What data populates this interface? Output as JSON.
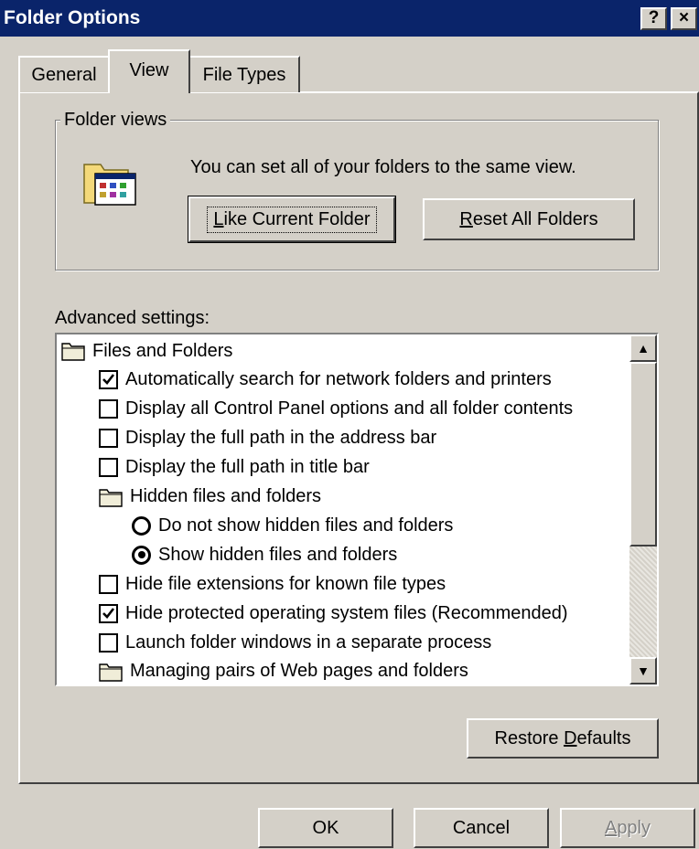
{
  "window": {
    "title": "Folder Options",
    "help_button": "?",
    "close_button": "×"
  },
  "tabs": [
    {
      "label": "General",
      "active": false
    },
    {
      "label": "View",
      "active": true
    },
    {
      "label": "File Types",
      "active": false
    }
  ],
  "folder_views": {
    "legend": "Folder views",
    "icon": "folder-view-icon",
    "description": "You can set all of your folders to the same view.",
    "like_current_prefix": "",
    "like_current_accel": "L",
    "like_current_rest": "ike Current Folder",
    "reset_all_prefix": "",
    "reset_all_accel": "R",
    "reset_all_rest": "eset All Folders"
  },
  "advanced": {
    "label": "Advanced settings:",
    "items": [
      {
        "type": "folder",
        "text": "Files and Folders",
        "indent": 0
      },
      {
        "type": "checkbox",
        "checked": true,
        "text": "Automatically search for network folders and printers",
        "indent": 1
      },
      {
        "type": "checkbox",
        "checked": false,
        "text": "Display all Control Panel options and all folder contents",
        "indent": 1
      },
      {
        "type": "checkbox",
        "checked": false,
        "text": "Display the full path in the address bar",
        "indent": 1
      },
      {
        "type": "checkbox",
        "checked": false,
        "text": "Display the full path in title bar",
        "indent": 1
      },
      {
        "type": "folder",
        "text": "Hidden files and folders",
        "indent": 1
      },
      {
        "type": "radio",
        "checked": false,
        "text": "Do not show hidden files and folders",
        "indent": 2
      },
      {
        "type": "radio",
        "checked": true,
        "text": "Show hidden files and folders",
        "indent": 2
      },
      {
        "type": "checkbox",
        "checked": false,
        "text": "Hide file extensions for known file types",
        "indent": 1
      },
      {
        "type": "checkbox",
        "checked": true,
        "text": "Hide protected operating system files (Recommended)",
        "indent": 1
      },
      {
        "type": "checkbox",
        "checked": false,
        "text": "Launch folder windows in a separate process",
        "indent": 1
      },
      {
        "type": "folder",
        "text": "Managing pairs of Web pages and folders",
        "indent": 1
      }
    ]
  },
  "buttons": {
    "restore_prefix": "Restore ",
    "restore_accel": "D",
    "restore_rest": "efaults",
    "ok": "OK",
    "cancel": "Cancel",
    "apply_accel": "A",
    "apply_rest": "pply"
  }
}
